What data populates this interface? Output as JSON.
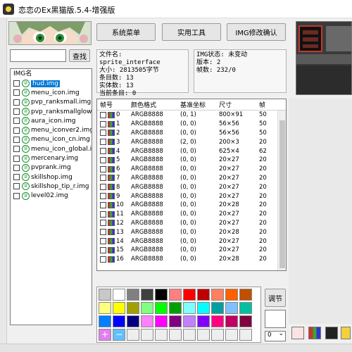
{
  "window": {
    "title": "恋恋のEx黑猫版.5.4-增强版"
  },
  "toolbar": {
    "system_menu": "系统菜单",
    "tools": "实用工具",
    "img_confirm": "IMG修改确认"
  },
  "search": {
    "placeholder": "",
    "button": "查找"
  },
  "file_info": {
    "name": "文件名: sprite_interface",
    "size": "大小: 2813505字节",
    "entries": "条目数: 13",
    "real_entries": "实体数: 13",
    "current": "当前条目: 0"
  },
  "img_info": {
    "status": "IMG状态: 未变动",
    "version": "版本: 2",
    "frames": "帧数: 232/0"
  },
  "img_list": {
    "header": "IMG名",
    "items": [
      {
        "label": "hud.img",
        "selected": true
      },
      {
        "label": "menu_icon.img"
      },
      {
        "label": "pvp_ranksmall.img"
      },
      {
        "label": "pvp_ranksmallglow.img"
      },
      {
        "label": "aura_icon.img"
      },
      {
        "label": "menu_iconver2.img"
      },
      {
        "label": "menu_icon_cn.img"
      },
      {
        "label": "menu_icon_global.img"
      },
      {
        "label": "mercenary.img"
      },
      {
        "label": "pvprank.img"
      },
      {
        "label": "skillshop.img"
      },
      {
        "label": "skillshop_tip_r.img"
      },
      {
        "label": "level02.img"
      }
    ]
  },
  "frames": {
    "headers": [
      "帧号",
      "颜色格式",
      "基准坐标",
      "尺寸",
      "帧"
    ],
    "rows": [
      {
        "idx": "0",
        "fmt": "ARGB8888",
        "pos": "(0, 1)",
        "size": "800×91",
        "x": "50"
      },
      {
        "idx": "1",
        "fmt": "ARGB8888",
        "pos": "(0, 0)",
        "size": "56×56",
        "x": "50"
      },
      {
        "idx": "2",
        "fmt": "ARGB8888",
        "pos": "(0, 0)",
        "size": "56×56",
        "x": "50"
      },
      {
        "idx": "3",
        "fmt": "ARGB8888",
        "pos": "(2, 0)",
        "size": "200×3",
        "x": "20"
      },
      {
        "idx": "4",
        "fmt": "ARGB8888",
        "pos": "(0, 0)",
        "size": "625×4",
        "x": "62"
      },
      {
        "idx": "5",
        "fmt": "ARGB8888",
        "pos": "(0, 0)",
        "size": "20×27",
        "x": "20"
      },
      {
        "idx": "6",
        "fmt": "ARGB8888",
        "pos": "(0, 0)",
        "size": "20×27",
        "x": "20"
      },
      {
        "idx": "7",
        "fmt": "ARGB8888",
        "pos": "(0, 0)",
        "size": "20×27",
        "x": "20"
      },
      {
        "idx": "8",
        "fmt": "ARGB8888",
        "pos": "(0, 0)",
        "size": "20×27",
        "x": "20"
      },
      {
        "idx": "9",
        "fmt": "ARGB8888",
        "pos": "(0, 0)",
        "size": "20×27",
        "x": "20"
      },
      {
        "idx": "10",
        "fmt": "ARGB8888",
        "pos": "(0, 0)",
        "size": "20×28",
        "x": "20"
      },
      {
        "idx": "11",
        "fmt": "ARGB8888",
        "pos": "(0, 0)",
        "size": "20×27",
        "x": "20"
      },
      {
        "idx": "12",
        "fmt": "ARGB8888",
        "pos": "(0, 0)",
        "size": "20×27",
        "x": "20"
      },
      {
        "idx": "13",
        "fmt": "ARGB8888",
        "pos": "(0, 0)",
        "size": "20×28",
        "x": "20"
      },
      {
        "idx": "14",
        "fmt": "ARGB8888",
        "pos": "(0, 0)",
        "size": "20×27",
        "x": "20"
      },
      {
        "idx": "15",
        "fmt": "ARGB8888",
        "pos": "(0, 0)",
        "size": "20×27",
        "x": "20"
      },
      {
        "idx": "16",
        "fmt": "ARGB8888",
        "pos": "(0, 0)",
        "size": "20×28",
        "x": "20"
      }
    ]
  },
  "palette": {
    "colors": [
      "#c8c8c8",
      "#ffffff",
      "#808080",
      "#404040",
      "#000000",
      "#ff8080",
      "#ff0000",
      "#c00000",
      "#ff8060",
      "#ff6000",
      "#c05000",
      "#ffff80",
      "#ffff00",
      "#a0a000",
      "#80ff80",
      "#00ff00",
      "#00a000",
      "#80ffff",
      "#00ffff",
      "#00a0a0",
      "#80c0ff",
      "#00c0a0",
      "#0080ff",
      "#0000ff",
      "#000080",
      "#ff80ff",
      "#ff00ff",
      "#800080",
      "#c080ff",
      "#8000ff",
      "#ff0080",
      "#c00060",
      "#800040"
    ]
  },
  "adjust": {
    "label": "调节"
  },
  "selector": {
    "value": "0"
  }
}
